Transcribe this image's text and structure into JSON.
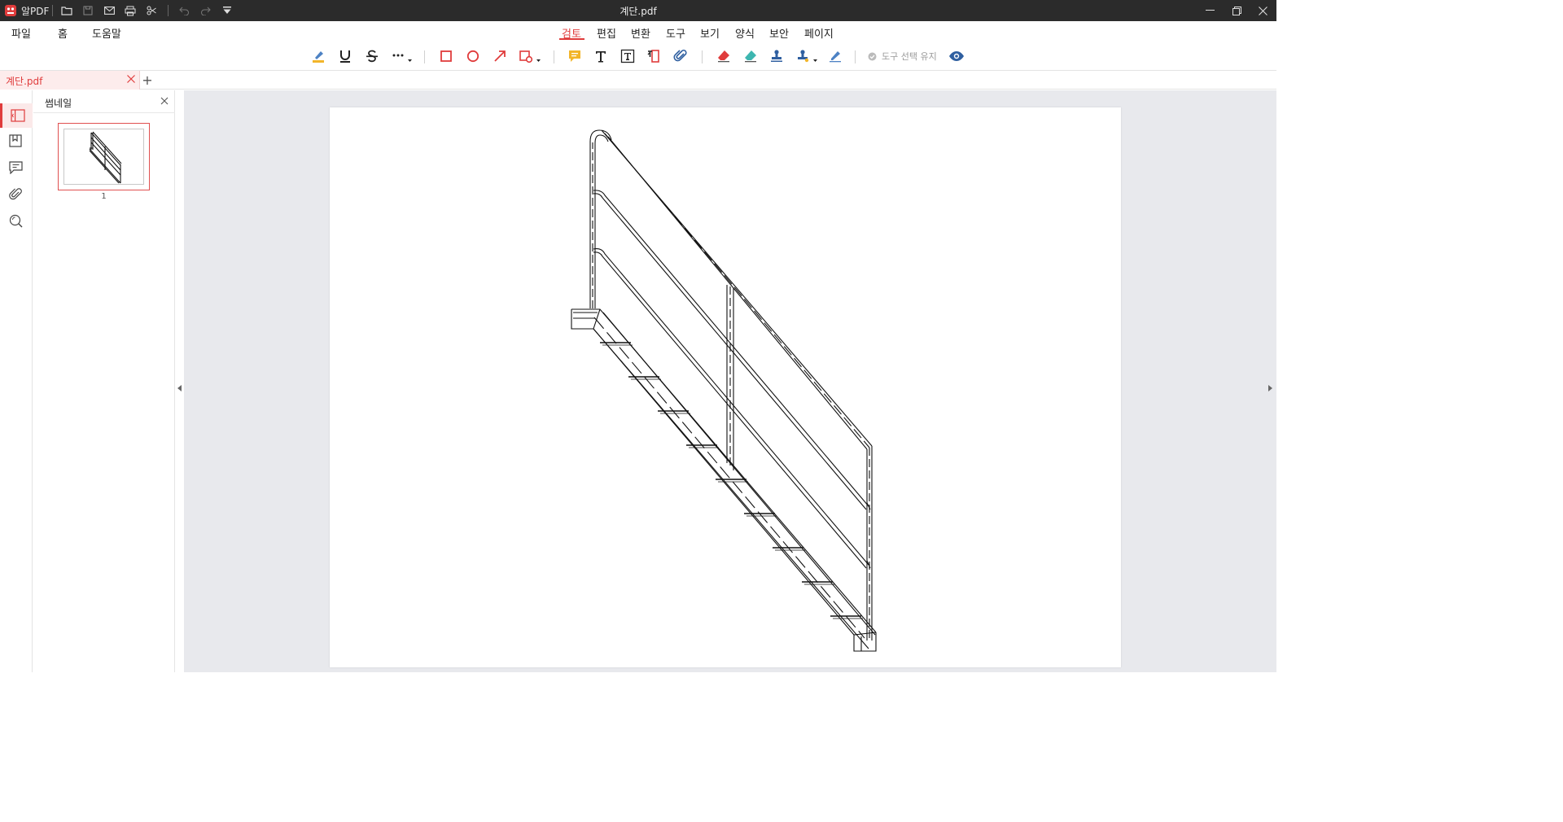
{
  "window": {
    "app_name": "알PDF",
    "document_title": "계단.pdf"
  },
  "menus": [
    "파일",
    "홈",
    "도움말"
  ],
  "ribbon_tabs": [
    {
      "label": "검토",
      "active": true
    },
    {
      "label": "편집",
      "active": false
    },
    {
      "label": "변환",
      "active": false
    },
    {
      "label": "도구",
      "active": false
    },
    {
      "label": "보기",
      "active": false
    },
    {
      "label": "양식",
      "active": false
    },
    {
      "label": "보안",
      "active": false
    },
    {
      "label": "페이지",
      "active": false
    }
  ],
  "toolbar": {
    "tools": [
      "highlight-icon",
      "underline-icon",
      "strikethrough-icon",
      "more-text-markup-icon",
      "rectangle-icon",
      "ellipse-icon",
      "arrow-icon",
      "shape-dropdown-icon",
      "sticky-note-icon",
      "text-icon",
      "textbox-icon",
      "callout-icon",
      "attach-file-icon",
      "eraser-red-icon",
      "eraser-teal-icon",
      "stamp-icon",
      "stamp-dropdown-icon",
      "signature-pen-icon"
    ],
    "keep_tool_label": "도구 선택 유지",
    "preview_icon": "eye-icon"
  },
  "tabs": {
    "open_document": "계단.pdf",
    "add_tab": "+"
  },
  "side_panel": {
    "title": "썸네일",
    "pages": [
      {
        "number": "1",
        "selected": true
      }
    ]
  },
  "colors": {
    "accent": "#e03c3c",
    "titlebar": "#2b2b2b",
    "canvas_bg": "#e8e9ed",
    "icon_blue": "#2f5fa0",
    "icon_yellow": "#f2b52a"
  }
}
